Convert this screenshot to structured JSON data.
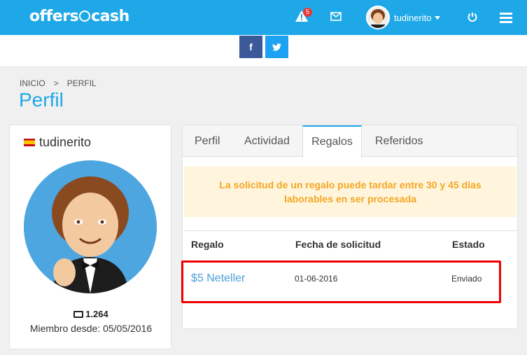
{
  "nav": {
    "logo_left": "offers",
    "logo_right": "cash",
    "alert_count": "5",
    "username": "tudinerito"
  },
  "social": {
    "facebook": "f",
    "twitter": "t"
  },
  "breadcrumb": {
    "home": "INICIO",
    "sep": ">",
    "current": "PERFIL"
  },
  "page": {
    "title": "Perfil"
  },
  "profile": {
    "name": "tudinerito",
    "points": "1.264",
    "member_since": "Miembro desde: 05/05/2016"
  },
  "tabs": [
    "Perfil",
    "Actividad",
    "Regalos",
    "Referidos"
  ],
  "notice": {
    "line1": "La solicitud de un regalo puede tardar entre 30 y 45 días",
    "line2": "laborables en ser procesada"
  },
  "table": {
    "headers": [
      "Regalo",
      "Fecha de solicitud",
      "Estado"
    ],
    "rows": [
      {
        "regalo": "$5 Neteller",
        "fecha": "01-06-2016",
        "estado": "Enviado"
      }
    ]
  },
  "colors": {
    "brand": "#1fa8e8",
    "warning_text": "#f5a623",
    "highlight": "#e00000"
  }
}
